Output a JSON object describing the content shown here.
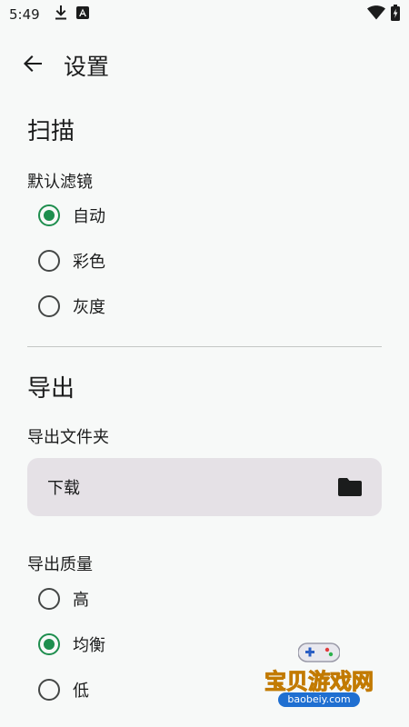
{
  "status_bar": {
    "time": "5:49"
  },
  "app_bar": {
    "title": "设置"
  },
  "scan": {
    "title": "扫描",
    "filter_label": "默认滤镜",
    "options": [
      {
        "label": "自动",
        "checked": true
      },
      {
        "label": "彩色",
        "checked": false
      },
      {
        "label": "灰度",
        "checked": false
      }
    ]
  },
  "export": {
    "title": "导出",
    "folder_label": "导出文件夹",
    "folder_value": "下载",
    "quality_label": "导出质量",
    "options": [
      {
        "label": "高",
        "checked": false
      },
      {
        "label": "均衡",
        "checked": true
      },
      {
        "label": "低",
        "checked": false
      }
    ]
  },
  "watermark": {
    "text": "宝贝游戏网",
    "url": "baobeiy.com"
  },
  "colors": {
    "accent": "#1e8e4e",
    "background": "#f7f9f8",
    "field_bg": "#e5e1e6"
  },
  "icons": [
    "download-icon",
    "android-icon",
    "wifi-icon",
    "battery-icon",
    "back-arrow-icon",
    "folder-icon",
    "gamepad-icon"
  ]
}
